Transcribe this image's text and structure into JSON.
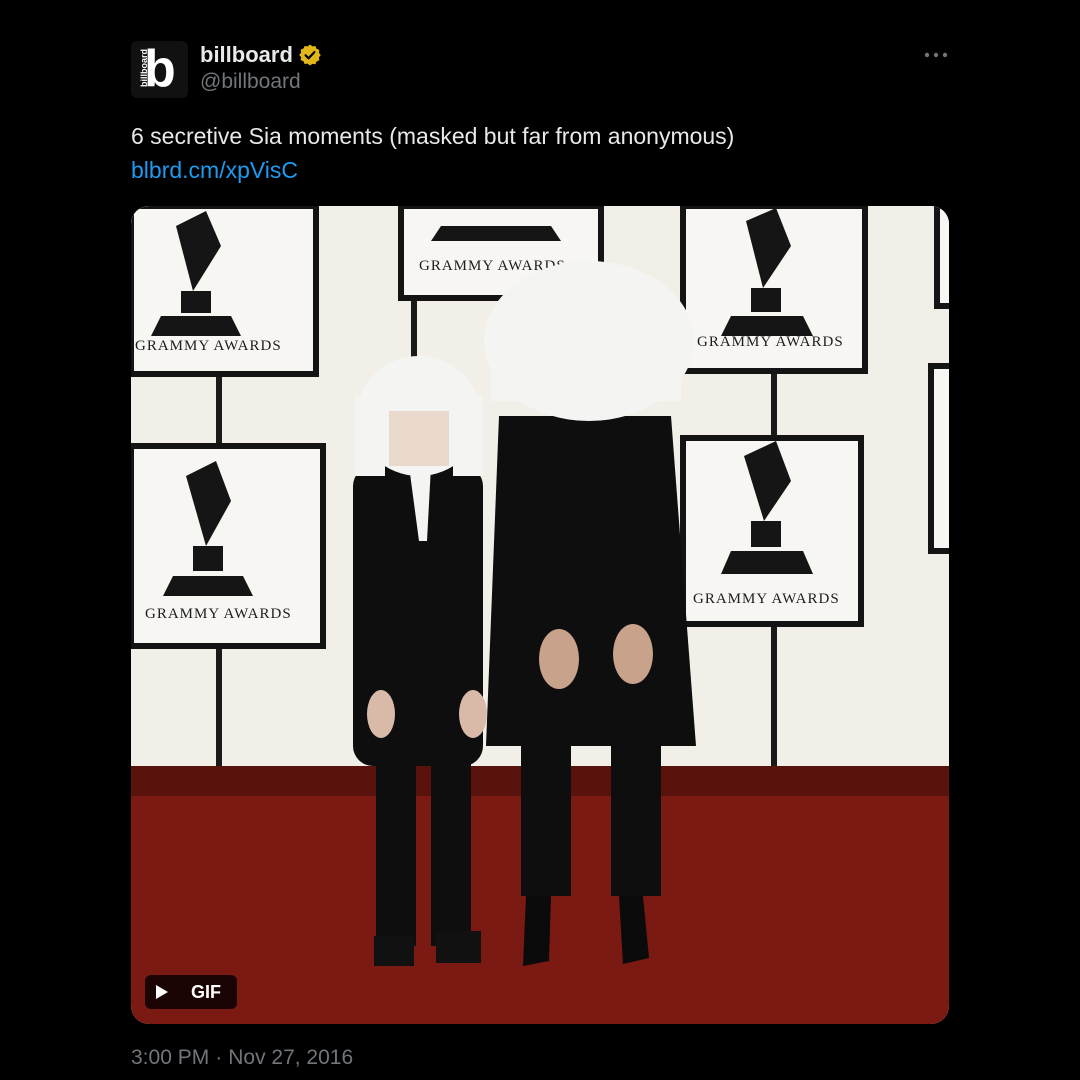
{
  "account": {
    "display_name": "billboard",
    "handle": "@billboard",
    "avatar_letter": "b",
    "avatar_wordmark": "billboard",
    "verified": true,
    "verified_color": "#e2b719"
  },
  "tweet": {
    "text": "6 secretive Sia moments (masked but far from anonymous)",
    "link": "blbrd.cm/xpVisC",
    "time": "3:00 PM",
    "separator": "·",
    "date": "Nov 27, 2016"
  },
  "media": {
    "type": "gif",
    "badge_label": "GIF",
    "backdrop_text": "GRAMMY AWARDS",
    "colors": {
      "wall": "#f2efe8",
      "carpet": "#7a1a12",
      "wig": "#f4f4f2",
      "outfit": "#0e0e0e"
    }
  },
  "icons": {
    "verified": "verified-badge-icon",
    "more": "more-options-icon",
    "play": "play-icon"
  },
  "colors": {
    "background": "#000000",
    "text": "#e7e9ea",
    "secondary": "#71767b",
    "link": "#1d9bf0"
  }
}
